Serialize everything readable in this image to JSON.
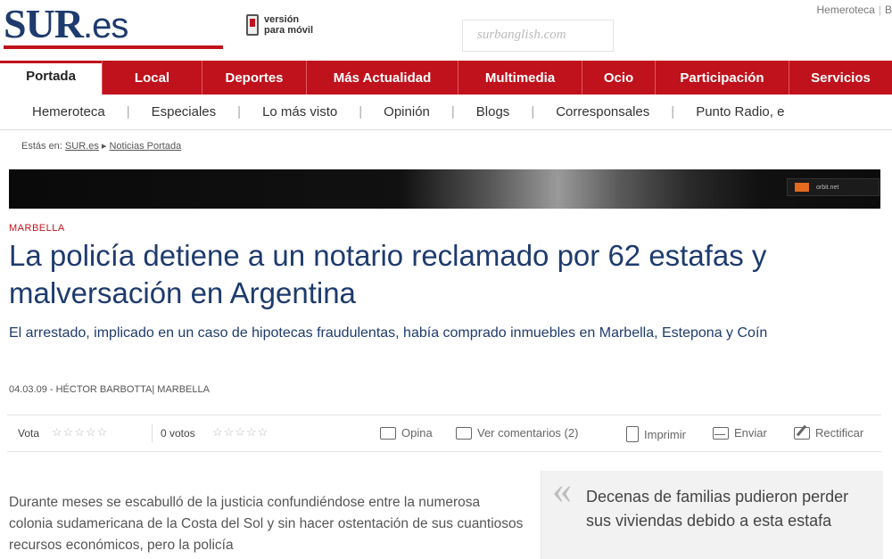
{
  "header": {
    "logo_main": "SUR",
    "logo_suffix": ".es",
    "mobile_line1": "versión",
    "mobile_line2": "para móvil",
    "watermark": "surbanglish.com",
    "top_link_1": "Hemeroteca",
    "top_link_2": "B"
  },
  "main_nav": {
    "home": "Portada",
    "items": [
      "Local",
      "Deportes",
      "Más Actualidad",
      "Multimedia",
      "Ocio",
      "Participación",
      "Servicios"
    ]
  },
  "sub_nav": {
    "items": [
      "Hemeroteca",
      "Especiales",
      "Lo más visto",
      "Opinión",
      "Blogs",
      "Corresponsales",
      "Punto Radio, e"
    ]
  },
  "breadcrumb": {
    "prefix": "Estás en:",
    "link1": "SUR.es",
    "separator": "▸",
    "link2": "Noticias Portada"
  },
  "banner": {
    "logo_text": "orbit.net"
  },
  "article": {
    "section": "MARBELLA",
    "headline": "La policía detiene a un notario reclamado por 62 estafas y malversación en Argentina",
    "subhead": "El arrestado, implicado en un caso de hipotecas fraudulentas, había comprado inmuebles en Marbella, Estepona y Coín",
    "byline": "04.03.09 - HÉCTOR BARBOTTA| MARBELLA",
    "body": "Durante meses se escabulló de la justicia confundiéndose entre la numerosa colonia sudamericana de la Costa del Sol y sin hacer ostentación de sus cuantiosos recursos económicos, pero la policía",
    "quote": "Decenas de familias pudieron perder sus viviendas debido a esta estafa"
  },
  "toolbar": {
    "vote_label": "Vota",
    "stars_empty": "☆☆☆☆☆",
    "votes_count": "0 votos",
    "opina": "Opina",
    "comments": "Ver comentarios (2)",
    "print": "Imprimir",
    "send": "Enviar",
    "rectify": "Rectificar"
  }
}
